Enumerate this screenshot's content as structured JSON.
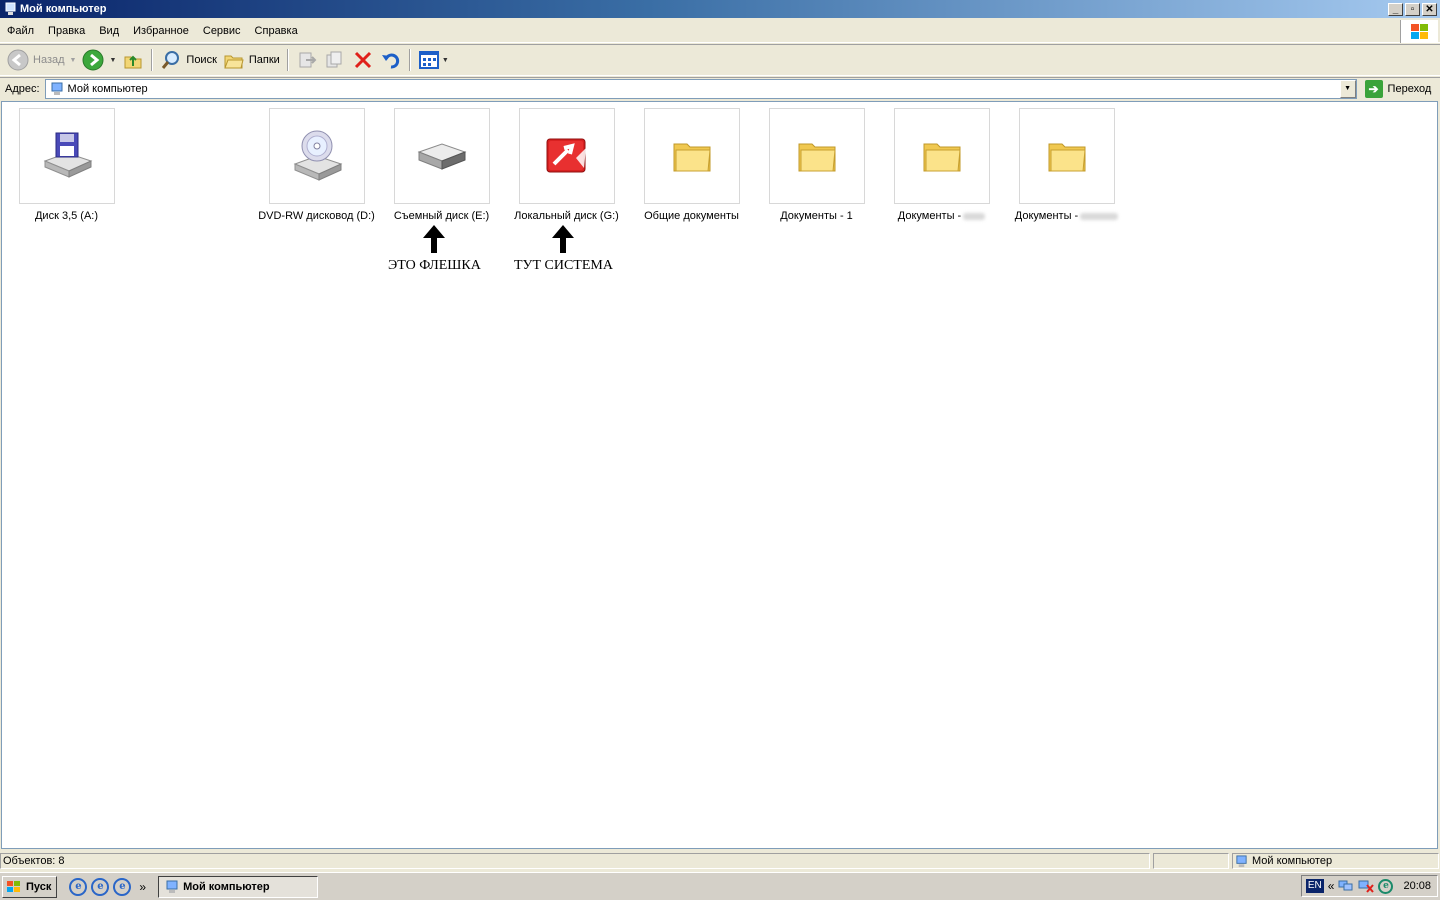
{
  "window": {
    "title": "Мой компьютер"
  },
  "menu": [
    "Файл",
    "Правка",
    "Вид",
    "Избранное",
    "Сервис",
    "Справка"
  ],
  "toolbar": {
    "back": "Назад",
    "search": "Поиск",
    "folders": "Папки"
  },
  "address": {
    "label": "Адрес:",
    "value": "Мой компьютер",
    "go": "Переход"
  },
  "items": [
    {
      "name": "Диск 3,5 (A:)",
      "icon": "floppy-drive-icon"
    },
    {
      "name": "DVD-RW дисковод (D:)",
      "icon": "dvd-drive-icon"
    },
    {
      "name": "Съемный диск (E:)",
      "icon": "removable-disk-icon"
    },
    {
      "name": "Локальный диск (G:)",
      "icon": "local-disk-icon"
    },
    {
      "name": "Общие документы",
      "icon": "folder-icon"
    },
    {
      "name": "Документы - 1",
      "icon": "folder-icon"
    },
    {
      "name": "Документы -",
      "icon": "folder-icon"
    },
    {
      "name": "Документы -",
      "icon": "folder-icon"
    }
  ],
  "annotations": {
    "flash": "ЭТО ФЛЕШКА",
    "system": "ТУТ СИСТЕМА"
  },
  "status": {
    "objects": "Объектов: 8",
    "location": "Мой компьютер"
  },
  "taskbar": {
    "start": "Пуск",
    "window": "Мой компьютер",
    "lang": "EN",
    "clock": "20:08"
  }
}
